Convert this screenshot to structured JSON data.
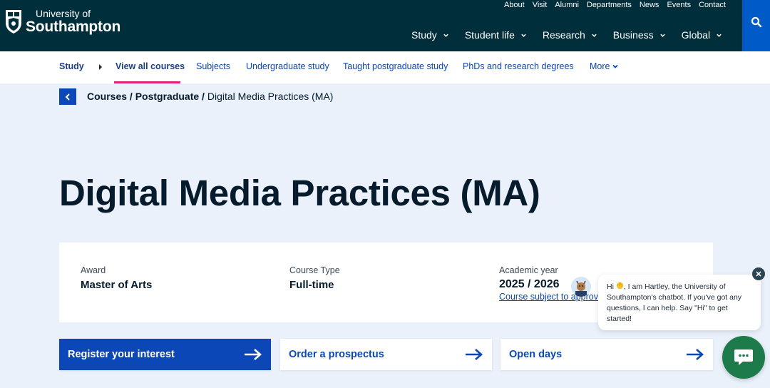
{
  "header": {
    "logo_line1": "University of",
    "logo_line2": "Southampton",
    "utility_links": [
      "About",
      "Visit",
      "Alumni",
      "Departments",
      "News",
      "Events",
      "Contact"
    ],
    "main_nav": [
      "Study",
      "Student life",
      "Research",
      "Business",
      "Global"
    ]
  },
  "subnav": {
    "section": "Study",
    "items": [
      "View all courses",
      "Subjects",
      "Undergraduate study",
      "Taught postgraduate study",
      "PhDs and research degrees",
      "More"
    ],
    "active": "View all courses"
  },
  "breadcrumb": {
    "courses": "Courses /",
    "postgraduate": "Postgraduate /",
    "current": "Digital Media Practices (MA)"
  },
  "page_title": "Digital Media Practices (MA)",
  "course_info": {
    "award_label": "Award",
    "award_value": "Master of Arts",
    "type_label": "Course Type",
    "type_value": "Full-time",
    "year_label": "Academic year",
    "year_value": "2025 / 2026",
    "year_note": "Course subject to approval"
  },
  "cta": {
    "register": "Register your interest",
    "prospectus": "Order a prospectus",
    "open_days": "Open days"
  },
  "chat": {
    "message_before": "Hi",
    "message_after": ", I am Hartley, the University of Southampton's chatbot. If you've got any questions, I can help. Say \"Hi\" to get started!"
  },
  "colors": {
    "header_bg": "#002e3b",
    "accent_blue": "#0c47b7",
    "search_blue": "#005ac8",
    "active_underline": "#e0217a",
    "page_bg": "#eaf1fb",
    "chat_green": "#1d7a4a"
  }
}
